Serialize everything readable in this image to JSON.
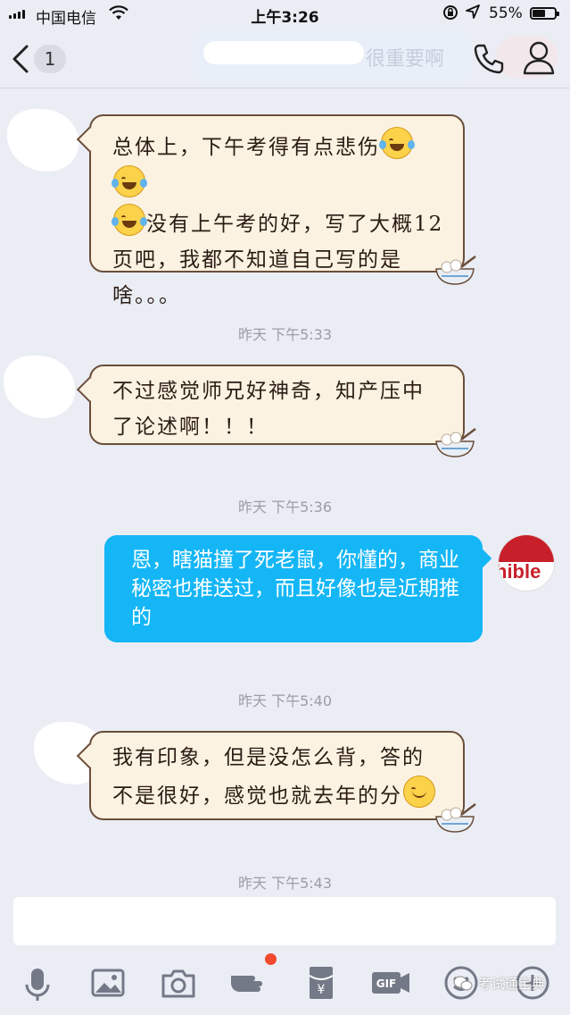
{
  "status_bar": {
    "carrier": "中国电信",
    "time": "上午3:26",
    "battery": "55%",
    "battery_level": 0.55
  },
  "nav": {
    "unread_count": "1",
    "title": "很重要啊"
  },
  "messages": [
    {
      "side": "left",
      "text_parts": [
        "总体上，下午考得有点悲伤",
        "没有上午考的好，写了大概12页吧，我都不知道自己写的是啥。。。"
      ],
      "emojis": [
        "tears-of-joy-icon",
        "tears-of-joy-icon",
        "tears-of-joy-icon"
      ]
    },
    {
      "timestamp": "昨天 下午5:33"
    },
    {
      "side": "left",
      "text": "不过感觉师兄好神奇，知产压中了论述啊！！！"
    },
    {
      "timestamp": "昨天 下午5:36"
    },
    {
      "side": "right",
      "text": "恩，瞎猫撞了死老鼠，你懂的，商业秘密也推送过，而且好像也是近期推的"
    },
    {
      "timestamp": "昨天 下午5:40"
    },
    {
      "side": "left",
      "text": "我有印象，但是没怎么背，答的不是很好，感觉也就去年的分",
      "emojis": [
        "blush-smile-icon"
      ]
    },
    {
      "timestamp": "昨天 下午5:43"
    }
  ],
  "my_avatar_text": "hible",
  "toolbar": [
    "microphone-icon",
    "image-icon",
    "camera-icon",
    "hand-icon",
    "red-packet-icon",
    "gif-icon",
    "emoji-icon",
    "plus-icon"
  ],
  "watermark": "考试通宝典"
}
